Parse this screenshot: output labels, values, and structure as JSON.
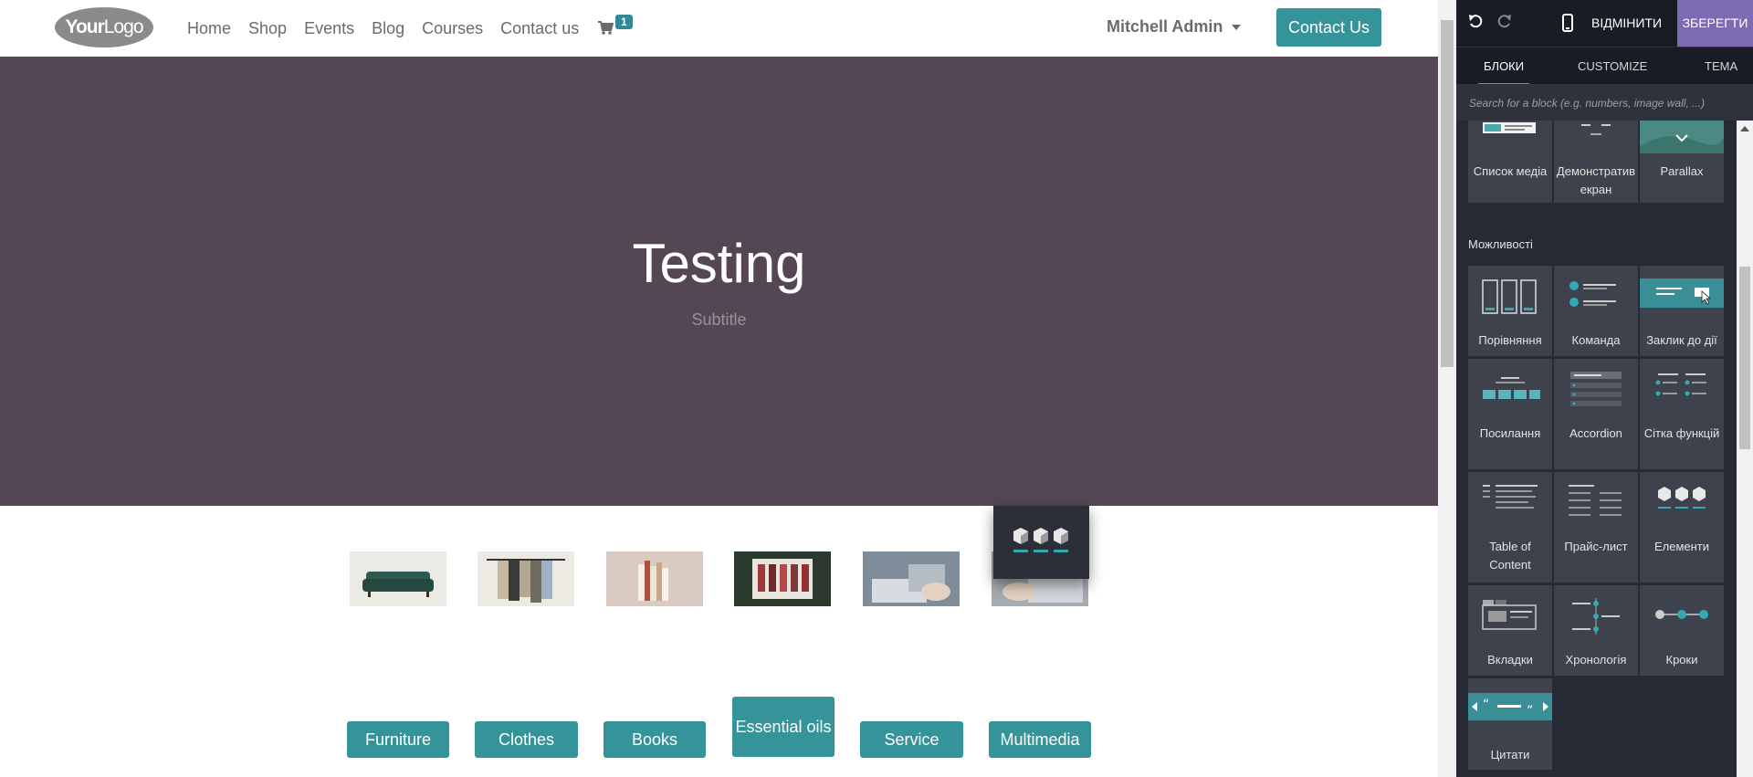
{
  "header": {
    "logo_text_1": "Your",
    "logo_text_2": "Logo",
    "nav": [
      "Home",
      "Shop",
      "Events",
      "Blog",
      "Courses",
      "Contact us"
    ],
    "cart_count": "1",
    "user_name": "Mitchell Admin",
    "contact_button": "Contact Us"
  },
  "hero": {
    "title": "Testing",
    "subtitle": "Subtitle"
  },
  "categories": [
    "Furniture",
    "Clothes",
    "Books",
    "Essential oils",
    "Service",
    "Multimedia"
  ],
  "editor": {
    "discard_label": "ВІДМІНИТИ",
    "save_label": "ЗБЕРЕГТИ",
    "tabs": [
      "БЛОКИ",
      "CUSTOMIZE",
      "ТЕМА"
    ],
    "search_placeholder": "Search for a block (e.g. numbers, image wall, ...)",
    "section_label": "Можливості",
    "top_blocks": [
      "Список медіа",
      "Демонстратив екран",
      "Parallax"
    ],
    "blocks": [
      "Порівняння",
      "Команда",
      "Заклик до дії",
      "Посилання",
      "Accordion",
      "Сітка функцій",
      "Table of Content",
      "Прайс-лист",
      "Елементи",
      "Вкладки",
      "Хронологія",
      "Кроки",
      "Цитати"
    ],
    "colors": {
      "accent": "#33a9b5",
      "save": "#7c6ab2",
      "panel": "#262a35"
    }
  }
}
